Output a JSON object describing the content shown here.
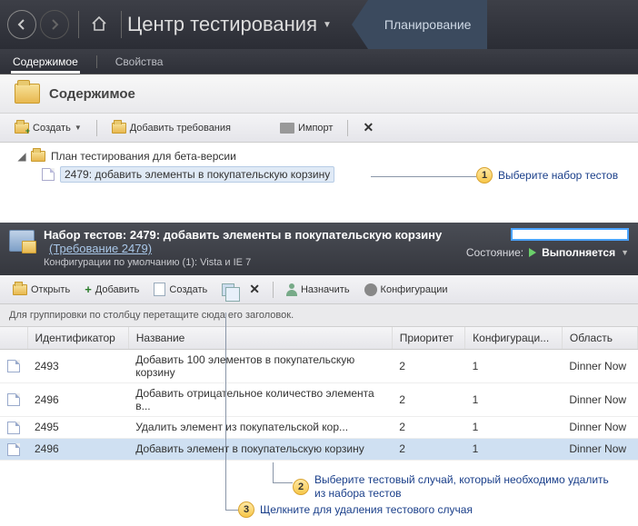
{
  "header": {
    "title": "Центр тестирования",
    "active_tab": "Планирование"
  },
  "sub_tabs": {
    "contents": "Содержимое",
    "properties": "Свойства"
  },
  "content": {
    "title": "Содержимое"
  },
  "toolbar1": {
    "create": "Создать",
    "add_req": "Добавить требования",
    "import": "Импорт"
  },
  "tree": {
    "root": "План тестирования для бета-версии",
    "child": "2479: добавить элементы в покупательскую корзину"
  },
  "callouts": {
    "c1": "Выберите набор тестов",
    "c2": "Выберите тестовый случай, который необходимо удалить из набора тестов",
    "c3": "Щелкните для удаления тестового случая"
  },
  "suite": {
    "title": "Набор тестов: 2479: добавить элементы в покупательскую корзину",
    "link": "(Требование 2479)",
    "sub": "Конфигурации по умолчанию (1): Vista и IE 7",
    "state_label": "Состояние:",
    "state_value": "Выполняется"
  },
  "toolbar2": {
    "open": "Открыть",
    "add": "Добавить",
    "create": "Создать",
    "assign": "Назначить",
    "config": "Конфигурации"
  },
  "group_hint": "Для группировки по столбцу перетащите сюда его заголовок.",
  "table": {
    "headers": {
      "id": "Идентификатор",
      "name": "Название",
      "priority": "Приоритет",
      "config": "Конфигураци...",
      "area": "Область"
    },
    "rows": [
      {
        "id": "2493",
        "name": "Добавить 100 элементов в покупательскую корзину",
        "priority": "2",
        "config": "1",
        "area": "Dinner Now"
      },
      {
        "id": "2496",
        "name": "Добавить отрицательное количество элемента в...",
        "priority": "2",
        "config": "1",
        "area": "Dinner Now"
      },
      {
        "id": "2495",
        "name": "Удалить элемент из покупательской кор...",
        "priority": "2",
        "config": "1",
        "area": "Dinner Now"
      },
      {
        "id": "2496",
        "name": "Добавить элемент в покупательскую корзину",
        "priority": "2",
        "config": "1",
        "area": "Dinner Now"
      }
    ]
  }
}
